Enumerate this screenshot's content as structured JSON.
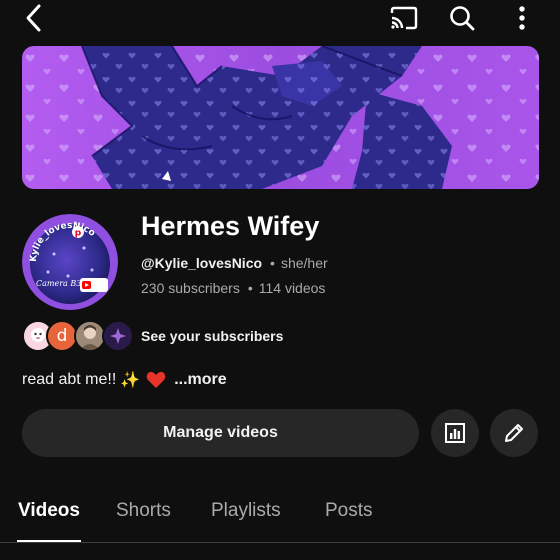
{
  "topbar": {
    "icons": [
      "back-arrow-icon",
      "cast-icon",
      "search-icon",
      "more-vertical-icon"
    ]
  },
  "channel": {
    "name": "Hermes Wifey",
    "handle": "@Kylie_lovesNico",
    "pronouns": "she/her",
    "subscribers": "230 subscribers",
    "videos": "114 videos",
    "avatar_text": "Kylie_lovesNico",
    "avatar_caption": "Camera B3"
  },
  "subscribers": {
    "see_label": "See your subscribers",
    "avatar_letter": "d"
  },
  "about": {
    "text": "read abt me!!",
    "emoji_sparkles": "✨",
    "emoji_heart": "❤️",
    "more_label": "...more"
  },
  "actions": {
    "manage_label": "Manage videos"
  },
  "tabs": [
    {
      "label": "Videos",
      "active": true
    },
    {
      "label": "Shorts",
      "active": false
    },
    {
      "label": "Playlists",
      "active": false
    },
    {
      "label": "Posts",
      "active": false
    }
  ],
  "colors": {
    "background": "#0f0f0f",
    "button_bg": "#272727",
    "banner_purple": "#9b4de0",
    "banner_indigo": "#2e2a8c",
    "sub_orange": "#e8643a"
  }
}
